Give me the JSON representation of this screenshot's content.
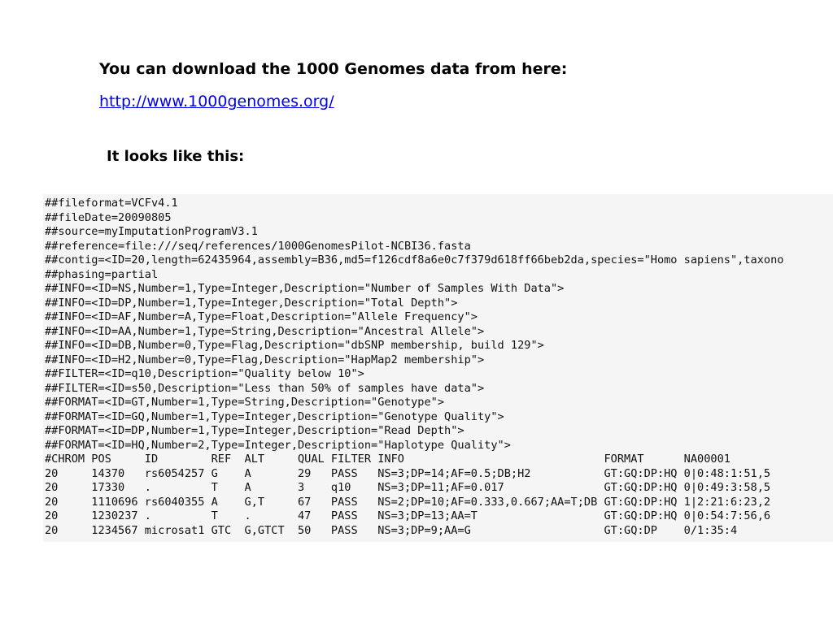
{
  "title": "You can download the 1000 Genomes data from here:",
  "link": "http://www.1000genomes.org/",
  "subtitle": "It looks like this:",
  "vcf_lines": [
    "##fileformat=VCFv4.1",
    "##fileDate=20090805",
    "##source=myImputationProgramV3.1",
    "##reference=file:///seq/references/1000GenomesPilot-NCBI36.fasta",
    "##contig=<ID=20,length=62435964,assembly=B36,md5=f126cdf8a6e0c7f379d618ff66beb2da,species=\"Homo sapiens\",taxono",
    "##phasing=partial",
    "##INFO=<ID=NS,Number=1,Type=Integer,Description=\"Number of Samples With Data\">",
    "##INFO=<ID=DP,Number=1,Type=Integer,Description=\"Total Depth\">",
    "##INFO=<ID=AF,Number=A,Type=Float,Description=\"Allele Frequency\">",
    "##INFO=<ID=AA,Number=1,Type=String,Description=\"Ancestral Allele\">",
    "##INFO=<ID=DB,Number=0,Type=Flag,Description=\"dbSNP membership, build 129\">",
    "##INFO=<ID=H2,Number=0,Type=Flag,Description=\"HapMap2 membership\">",
    "##FILTER=<ID=q10,Description=\"Quality below 10\">",
    "##FILTER=<ID=s50,Description=\"Less than 50% of samples have data\">",
    "##FORMAT=<ID=GT,Number=1,Type=String,Description=\"Genotype\">",
    "##FORMAT=<ID=GQ,Number=1,Type=Integer,Description=\"Genotype Quality\">",
    "##FORMAT=<ID=DP,Number=1,Type=Integer,Description=\"Read Depth\">",
    "##FORMAT=<ID=HQ,Number=2,Type=Integer,Description=\"Haplotype Quality\">",
    "#CHROM POS     ID        REF  ALT     QUAL FILTER INFO                              FORMAT      NA00001",
    "20     14370   rs6054257 G    A       29   PASS   NS=3;DP=14;AF=0.5;DB;H2           GT:GQ:DP:HQ 0|0:48:1:51,5",
    "20     17330   .         T    A       3    q10    NS=3;DP=11;AF=0.017               GT:GQ:DP:HQ 0|0:49:3:58,5",
    "20     1110696 rs6040355 A    G,T     67   PASS   NS=2;DP=10;AF=0.333,0.667;AA=T;DB GT:GQ:DP:HQ 1|2:21:6:23,2",
    "20     1230237 .         T    .       47   PASS   NS=3;DP=13;AA=T                   GT:GQ:DP:HQ 0|0:54:7:56,6",
    "20     1234567 microsat1 GTC  G,GTCT  50   PASS   NS=3;DP=9;AA=G                    GT:GQ:DP    0/1:35:4"
  ]
}
